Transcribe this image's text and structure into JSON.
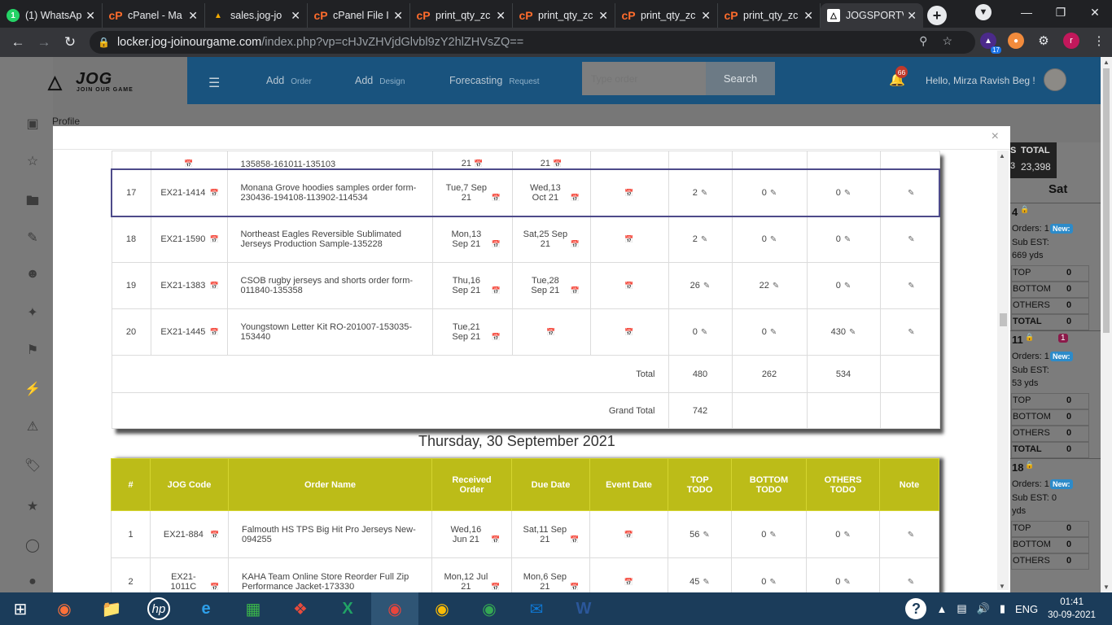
{
  "browser": {
    "tabs": [
      {
        "label": "(1) WhatsAp",
        "icon": "whatsapp-icon",
        "active": false
      },
      {
        "label": "cPanel - Ma",
        "icon": "cpanel-icon",
        "active": false
      },
      {
        "label": "sales.jog-jo",
        "icon": "sales-icon",
        "active": false
      },
      {
        "label": "cPanel File I",
        "icon": "cpanel-icon",
        "active": false
      },
      {
        "label": "print_qty_zc",
        "icon": "cpanel-icon",
        "active": false
      },
      {
        "label": "print_qty_zc",
        "icon": "cpanel-icon",
        "active": false
      },
      {
        "label": "print_qty_zc",
        "icon": "cpanel-icon",
        "active": false
      },
      {
        "label": "print_qty_zc",
        "icon": "cpanel-icon",
        "active": false
      },
      {
        "label": "JOGSPORTV",
        "icon": "jog-icon",
        "active": true
      }
    ],
    "profile_initial": "r",
    "url_main": "locker.jog-joinourgame.com",
    "url_rest": "/index.php?vp=cHJvZHVjdGlvbl9zY2hlZHVsZQ==",
    "ext_badge": "17"
  },
  "app": {
    "logo_text": "JOG",
    "logo_sub": "JOIN OUR GAME",
    "nav": [
      {
        "label": "Add",
        "sub": "Order"
      },
      {
        "label": "Add",
        "sub": "Design"
      },
      {
        "label": "Forecasting",
        "sub": "Request"
      }
    ],
    "search_placeholder": "Type order",
    "search_label": "Search",
    "notif_count": "66",
    "greeting": "Hello, Mirza Ravish Beg !",
    "sidebar_profile": "Profile"
  },
  "bg_panel": {
    "total_head": "TOTAL",
    "total_val": "23,398",
    "partial_head": "S",
    "partial_val": "3",
    "day": "Sat",
    "cards": [
      {
        "num": "4",
        "orders": "Orders: 1",
        "new": "New:",
        "est_label": "Sub EST:",
        "est_val": "669 yds",
        "rows": [
          [
            "TOP",
            "0"
          ],
          [
            "BOTTOM",
            "0"
          ],
          [
            "OTHERS",
            "0"
          ],
          [
            "TOTAL",
            "0"
          ]
        ]
      },
      {
        "num": "11",
        "badge": "1",
        "orders": "Orders: 1",
        "new": "New:",
        "est_label": "Sub EST:",
        "est_val": "53 yds",
        "rows": [
          [
            "TOP",
            "0"
          ],
          [
            "BOTTOM",
            "0"
          ],
          [
            "OTHERS",
            "0"
          ],
          [
            "TOTAL",
            "0"
          ]
        ]
      },
      {
        "num": "18",
        "orders": "Orders: 1",
        "new": "New:",
        "est_label": "Sub EST: 0",
        "est_val": "yds",
        "rows": [
          [
            "TOP",
            "0"
          ],
          [
            "BOTTOM",
            "0"
          ],
          [
            "OTHERS",
            "0"
          ]
        ]
      }
    ]
  },
  "modal": {
    "partial_top_row": {
      "code_tail": "",
      "name_tail": "135858-161011-135103",
      "rec_tail": "21",
      "due_tail": "21"
    },
    "rows": [
      {
        "n": "17",
        "code": "EX21-1414",
        "name": "Monana Grove hoodies samples order form-230436-194108-113902-114534",
        "rec": "Tue,7 Sep 21",
        "due": "Wed,13 Oct 21",
        "top": "2",
        "bottom": "0",
        "others": "0",
        "highlight": true
      },
      {
        "n": "18",
        "code": "EX21-1590",
        "name": "Northeast Eagles Reversible Sublimated Jerseys Production Sample-135228",
        "rec": "Mon,13 Sep 21",
        "due": "Sat,25 Sep 21",
        "top": "2",
        "bottom": "0",
        "others": "0"
      },
      {
        "n": "19",
        "code": "EX21-1383",
        "name": "CSOB rugby jerseys and shorts order form-011840-135358",
        "rec": "Thu,16 Sep 21",
        "due": "Tue,28 Sep 21",
        "top": "26",
        "bottom": "22",
        "others": "0"
      },
      {
        "n": "20",
        "code": "EX21-1445",
        "name": "Youngstown Letter Kit RO-201007-153035-153440",
        "rec": "Tue,21 Sep 21",
        "due": "",
        "top": "0",
        "bottom": "0",
        "others": "430"
      }
    ],
    "total_label": "Total",
    "totals": {
      "top": "480",
      "bottom": "262",
      "others": "534"
    },
    "grand_label": "Grand Total",
    "grand_total": "742",
    "day_title": "Thursday, 30 September 2021",
    "headers": [
      "#",
      "JOG Code",
      "Order Name",
      "Received Order",
      "Due Date",
      "Event Date",
      "TOP TODO",
      "BOTTOM TODO",
      "OTHERS TODO",
      "Note"
    ],
    "rows2": [
      {
        "n": "1",
        "code": "EX21-884",
        "name": "Falmouth HS TPS Big Hit Pro Jerseys New-094255",
        "rec": "Wed,16 Jun 21",
        "due": "Sat,11 Sep 21",
        "top": "56",
        "bottom": "0",
        "others": "0"
      },
      {
        "n": "2",
        "code": "EX21-1011C",
        "name": "KAHA Team Online Store Reorder Full Zip Performance Jacket-173330",
        "rec": "Mon,12 Jul 21",
        "due": "Mon,6 Sep 21",
        "top": "45",
        "bottom": "0",
        "others": "0"
      }
    ]
  },
  "taskbar": {
    "lang": "ENG",
    "time": "01:41",
    "date": "30-09-2021"
  }
}
